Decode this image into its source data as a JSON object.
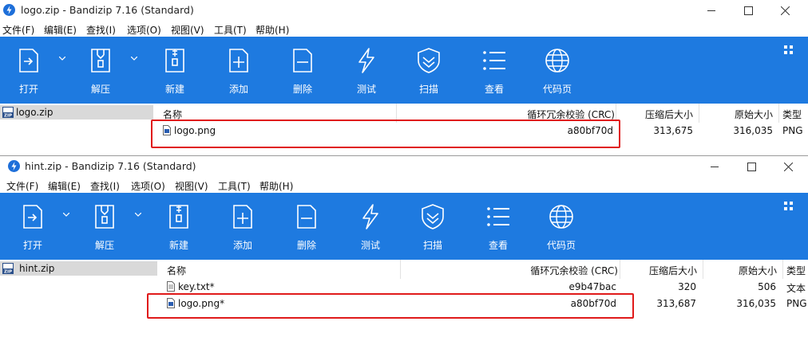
{
  "windows": [
    {
      "title": "logo.zip - Bandizip 7.16 (Standard)",
      "menu": [
        "文件(F)",
        "编辑(E)",
        "查找(I)",
        "选项(O)",
        "视图(V)",
        "工具(T)",
        "帮助(H)"
      ],
      "toolbar": [
        "打开",
        "解压",
        "新建",
        "添加",
        "删除",
        "测试",
        "扫描",
        "查看",
        "代码页"
      ],
      "tree_item": "logo.zip",
      "headers": [
        "名称",
        "循环冗余校验 (CRC)",
        "压缩后大小",
        "原始大小",
        "类型"
      ],
      "rows": [
        {
          "name": "logo.png",
          "crc": "a80bf70d",
          "compressed": "313,675",
          "original": "316,035",
          "type": "PNG"
        }
      ]
    },
    {
      "title": "hint.zip - Bandizip 7.16 (Standard)",
      "menu": [
        "文件(F)",
        "编辑(E)",
        "查找(I)",
        "选项(O)",
        "视图(V)",
        "工具(T)",
        "帮助(H)"
      ],
      "toolbar": [
        "打开",
        "解压",
        "新建",
        "添加",
        "删除",
        "测试",
        "扫描",
        "查看",
        "代码页"
      ],
      "tree_item": "hint.zip",
      "headers": [
        "名称",
        "循环冗余校验 (CRC)",
        "压缩后大小",
        "原始大小",
        "类型"
      ],
      "rows": [
        {
          "name": "key.txt*",
          "crc": "e9b47bac",
          "compressed": "320",
          "original": "506",
          "type": "文本"
        },
        {
          "name": "logo.png*",
          "crc": "a80bf70d",
          "compressed": "313,687",
          "original": "316,035",
          "type": "PNG"
        }
      ]
    }
  ],
  "colors": {
    "toolbar_bg": "#1e7ae0",
    "highlight_box": "#e01a1a",
    "tree_selected": "#d9d9d9"
  },
  "icons": [
    "open-icon",
    "extract-icon",
    "new-archive-icon",
    "add-icon",
    "delete-icon",
    "test-icon",
    "scan-icon",
    "view-icon",
    "codepage-icon"
  ]
}
